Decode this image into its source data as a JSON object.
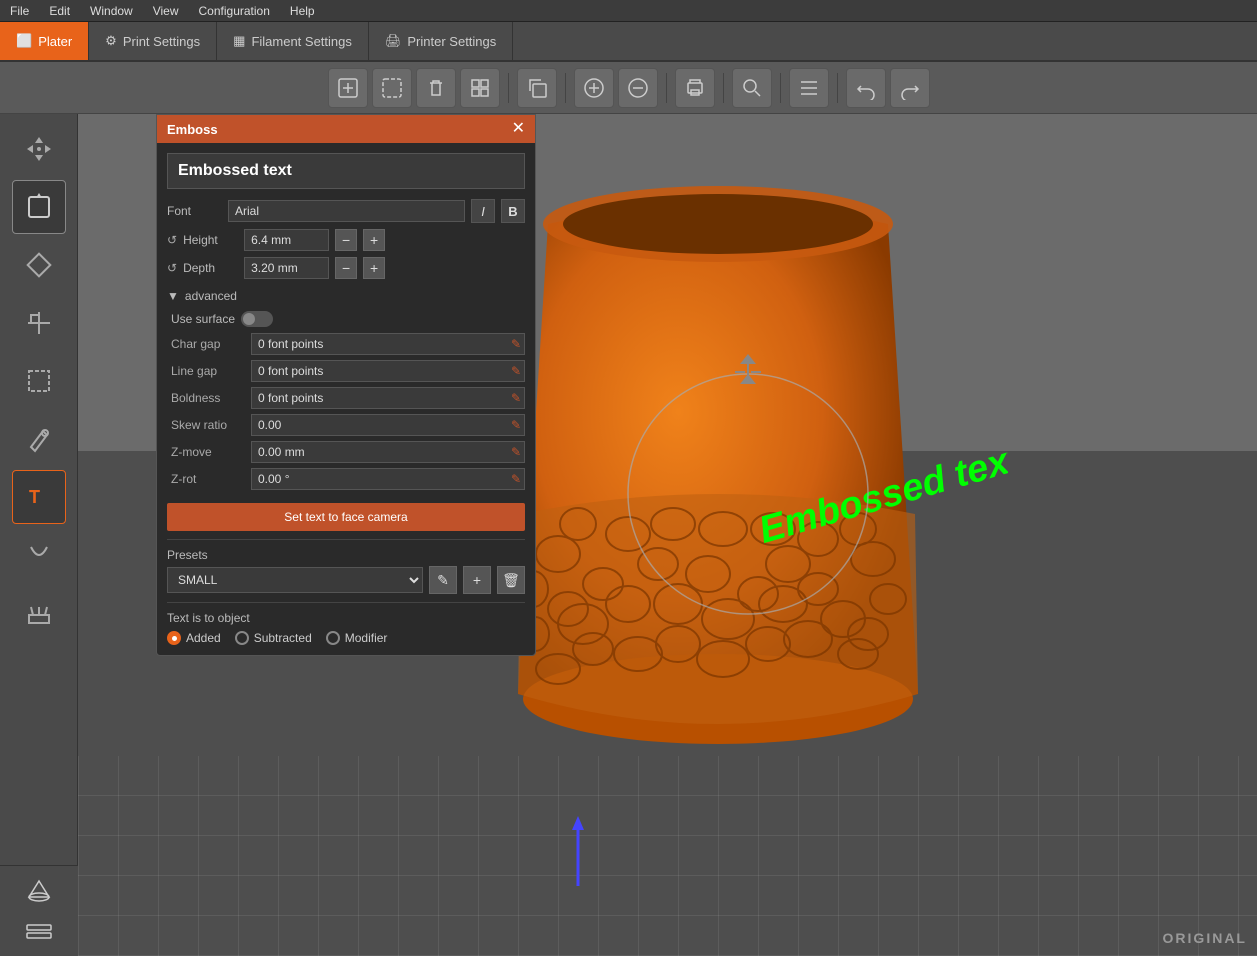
{
  "menubar": {
    "items": [
      "File",
      "Edit",
      "Window",
      "View",
      "Configuration",
      "Help"
    ]
  },
  "tabs": [
    {
      "label": "Plater",
      "icon": "🖥",
      "active": true
    },
    {
      "label": "Print Settings",
      "icon": "⚙",
      "active": false
    },
    {
      "label": "Filament Settings",
      "icon": "🧵",
      "active": false
    },
    {
      "label": "Printer Settings",
      "icon": "🖨",
      "active": false
    }
  ],
  "emboss_panel": {
    "title": "Emboss",
    "text_display": "Embossed text",
    "font_label": "Font",
    "font_value": "Arial",
    "height_label": "Height",
    "height_value": "6.4 mm",
    "depth_label": "Depth",
    "depth_value": "3.20 mm",
    "advanced_label": "advanced",
    "use_surface_label": "Use surface",
    "char_gap_label": "Char gap",
    "char_gap_value": "0 font points",
    "line_gap_label": "Line gap",
    "line_gap_value": "0 font points",
    "boldness_label": "Boldness",
    "boldness_value": "0 font points",
    "skew_label": "Skew ratio",
    "skew_value": "0.00",
    "zmove_label": "Z-move",
    "zmove_value": "0.00 mm",
    "zrot_label": "Z-rot",
    "zrot_value": "0.00 °",
    "set_text_btn": "Set text to face camera",
    "presets_label": "Presets",
    "presets_value": "SMALL",
    "text_object_label": "Text is to object",
    "radio_items": [
      "Added",
      "Subtracted",
      "Modifier"
    ]
  },
  "viewport": {
    "watermark": "ORIGINAL"
  }
}
